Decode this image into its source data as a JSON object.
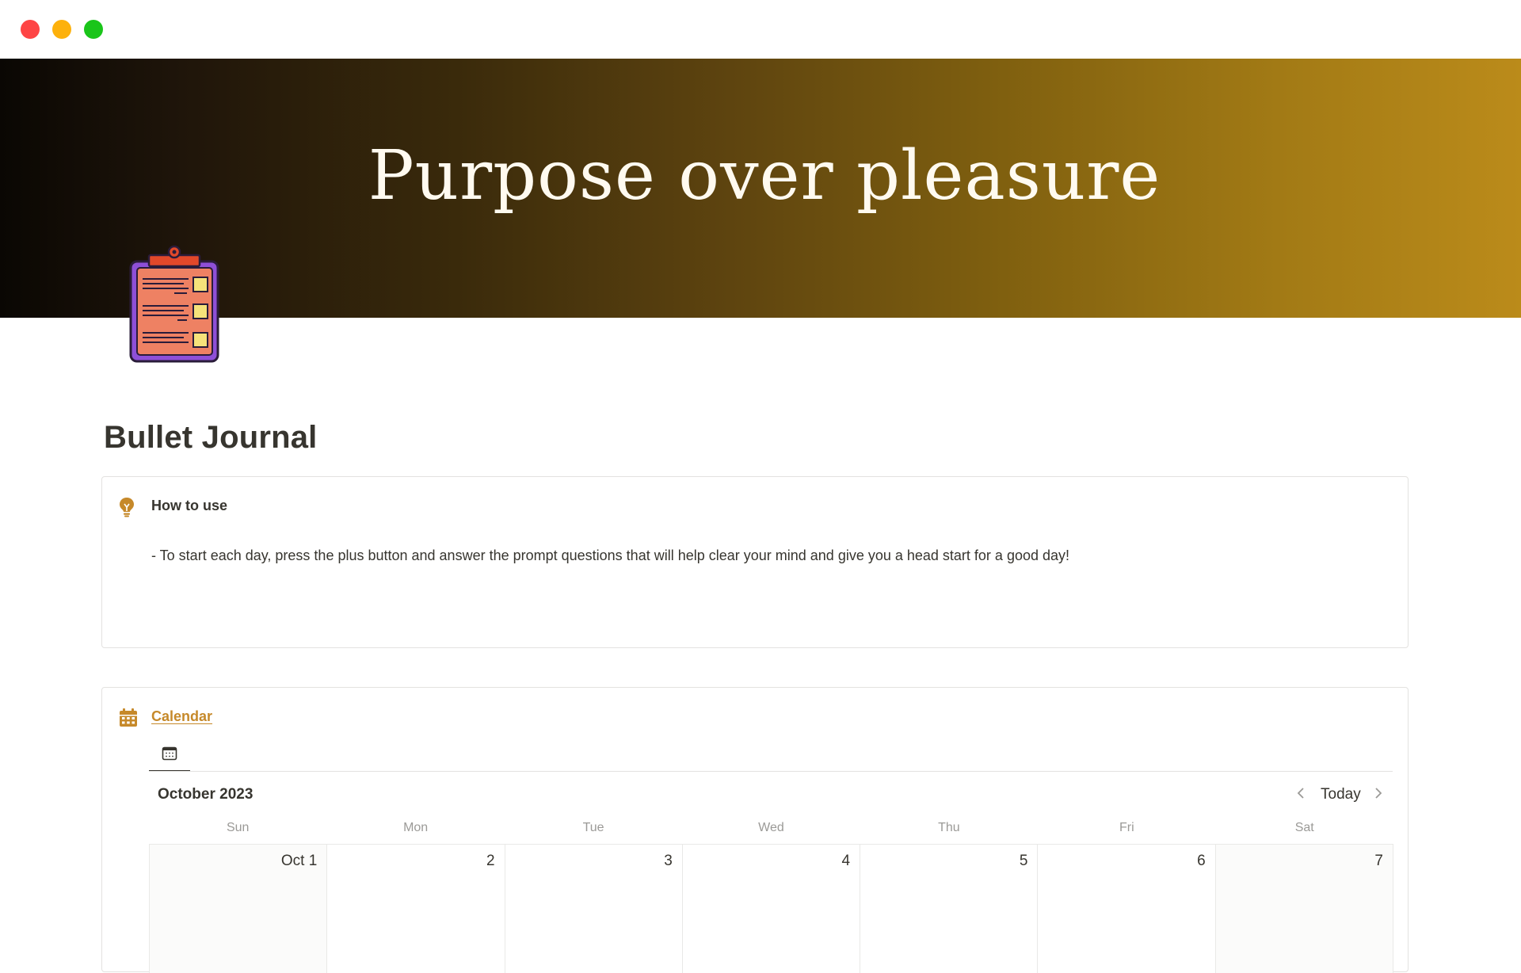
{
  "window": {
    "controls": [
      "close",
      "minimize",
      "maximize"
    ]
  },
  "cover": {
    "title": "Purpose over pleasure",
    "gradient_colors": [
      "#0a0703",
      "#5e440f",
      "#bb8b1a"
    ]
  },
  "page": {
    "icon": "clipboard-checklist-icon",
    "title": "Bullet Journal"
  },
  "callout": {
    "icon": "lightbulb-icon",
    "heading": "How to use",
    "text": "- To start each day, press the plus button and answer the prompt questions that will help clear your mind and give you a head start for a good day!"
  },
  "calendar": {
    "icon": "calendar-icon",
    "title": "Calendar",
    "accent_color": "#c6892a",
    "view_tab_icon": "calendar-view-icon",
    "month": "October 2023",
    "nav": {
      "prev_icon": "chevron-left-icon",
      "today": "Today",
      "next_icon": "chevron-right-icon"
    },
    "weekdays": [
      "Sun",
      "Mon",
      "Tue",
      "Wed",
      "Thu",
      "Fri",
      "Sat"
    ],
    "days": [
      "Oct 1",
      "2",
      "3",
      "4",
      "5",
      "6",
      "7"
    ]
  }
}
